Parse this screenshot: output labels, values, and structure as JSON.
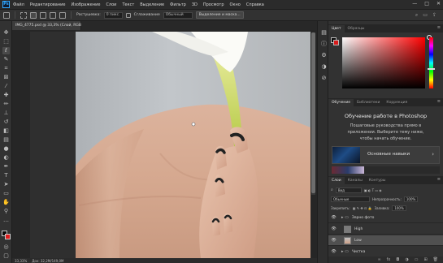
{
  "app": {
    "logo": "Ps",
    "menu": [
      "Файл",
      "Редактирование",
      "Изображение",
      "Слои",
      "Текст",
      "Выделение",
      "Фильтр",
      "3D",
      "Просмотр",
      "Окно",
      "Справка"
    ],
    "window_controls": [
      "—",
      "□",
      "✕"
    ]
  },
  "options": {
    "feather_label": "Растушевка:",
    "feather_value": "0 пикс.",
    "antialias_label": "Сглаживание",
    "style_value": "Обычный",
    "select_mask_button": "Выделение и маска..."
  },
  "document": {
    "tab_title": "IMG_4775.psd @ 33,3% (Слой, RGB/8*)",
    "close": "×",
    "status_zoom": "33,33%",
    "status_info": "Док: 32,2M/149,0M"
  },
  "panels": {
    "color_tabs": [
      "Цвет",
      "Образцы"
    ],
    "learn_tabs": [
      "Обучение",
      "Библиотеки",
      "Коррекция"
    ],
    "learn_title": "Обучение работе в Photoshop",
    "learn_desc": "Пошаговые руководства прямо в приложении. Выберите тему ниже, чтобы начать обучение.",
    "learn_card_label": "Основные навыки",
    "layers_tabs": [
      "Слои",
      "Каналы",
      "Контуры"
    ],
    "layers_filter": "Вид",
    "blend_mode": "Обычные",
    "opacity_label": "Непрозрачность:",
    "opacity_value": "100%",
    "lock_label": "Закрепить:",
    "fill_label": "Заливка:",
    "fill_value": "100%",
    "layers": [
      {
        "name": "Зерно фото"
      },
      {
        "name": "High"
      },
      {
        "name": "Low"
      },
      {
        "name": "Чистка"
      }
    ]
  },
  "colors": {
    "foreground": "#0a0a0a",
    "background": "#e01b1b",
    "accent": "#31a8ff"
  },
  "icons": {
    "toolbar": [
      "move-icon",
      "marquee-icon",
      "lasso-icon",
      "quick-select-icon",
      "crop-icon",
      "frame-icon",
      "eyedropper-icon",
      "healing-icon",
      "brush-icon",
      "stamp-icon",
      "history-brush-icon",
      "eraser-icon",
      "gradient-icon",
      "blur-icon",
      "dodge-icon",
      "pen-icon",
      "type-icon",
      "path-select-icon",
      "shape-icon",
      "hand-icon",
      "zoom-icon",
      "more-icon"
    ],
    "strip": [
      "histogram-icon",
      "info-icon",
      "properties-icon",
      "adjustments-icon",
      "history-icon"
    ]
  }
}
